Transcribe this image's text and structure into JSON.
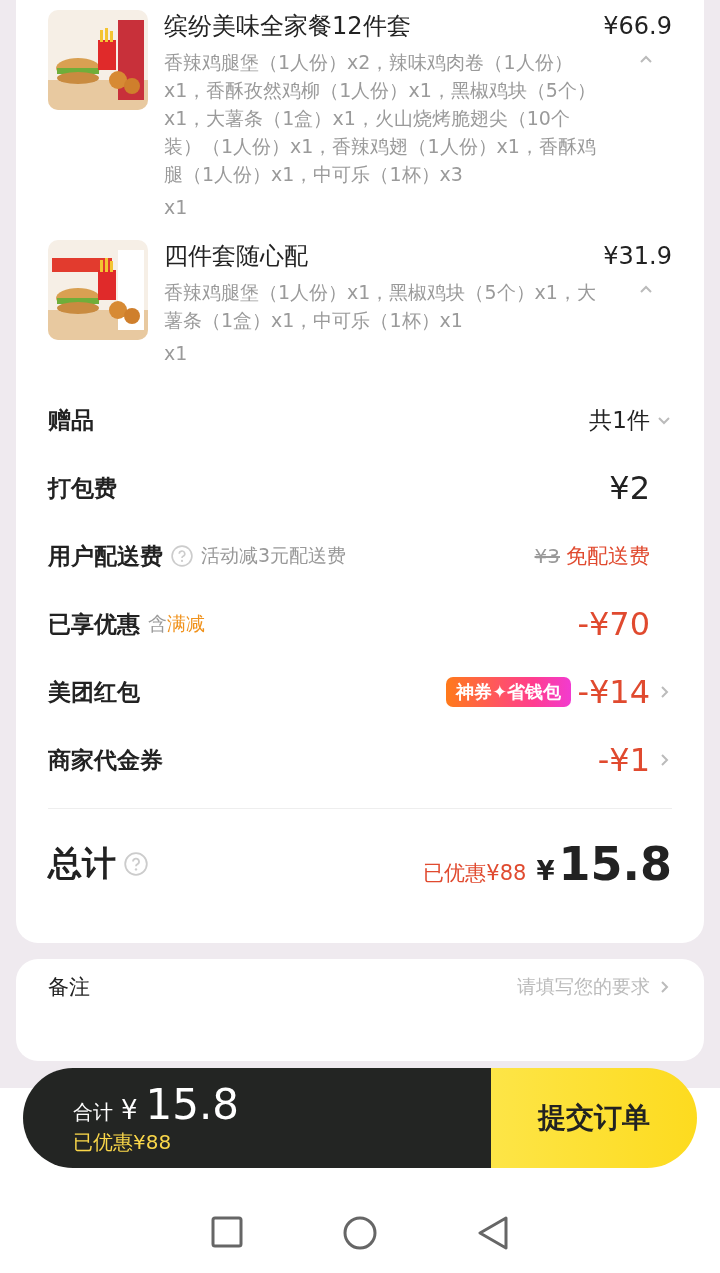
{
  "items": [
    {
      "title": "缤纷美味全家餐12件套",
      "price": "¥66.9",
      "description": "香辣鸡腿堡（1人份）x2，辣味鸡肉卷（1人份）x1，香酥孜然鸡柳（1人份）x1，黑椒鸡块（5个）x1，大薯条（1盒）x1，火山烧烤脆翅尖（10个装）（1人份）x1，香辣鸡翅（1人份）x1，香酥鸡腿（1人份）x1，中可乐（1杯）x3",
      "quantity": "x1",
      "expanded": true
    },
    {
      "title": "四件套随心配",
      "price": "¥31.9",
      "description": "香辣鸡腿堡（1人份）x1，黑椒鸡块（5个）x1，大薯条（1盒）x1，中可乐（1杯）x1",
      "quantity": "x1",
      "expanded": true
    }
  ],
  "rows": [
    {
      "kind": "gift",
      "label": "赠品",
      "value": "共1件",
      "expanded": false
    },
    {
      "kind": "plain",
      "label": "打包费",
      "value": "¥2"
    },
    {
      "kind": "delivery",
      "label": "用户配送费",
      "note": "活动减3元配送费",
      "original": "¥3",
      "value": "免配送费"
    },
    {
      "kind": "discount",
      "label": "已享优惠",
      "prefix": "含",
      "tag": "满减",
      "value": "-¥70"
    },
    {
      "kind": "redpacket",
      "label": "美团红包",
      "badge": "神券✦省钱包",
      "value": "-¥14"
    },
    {
      "kind": "voucher",
      "label": "商家代金券",
      "value": "-¥1"
    }
  ],
  "total": {
    "label": "总计",
    "saved": "已优惠¥88",
    "currency": "¥",
    "amount": "15.8"
  },
  "note": {
    "label": "备注",
    "placeholder": "请填写您的要求"
  },
  "footer": {
    "label": "合计",
    "currency": "¥",
    "amount": "15.8",
    "saved": "已优惠¥88",
    "submit": "提交订单"
  }
}
